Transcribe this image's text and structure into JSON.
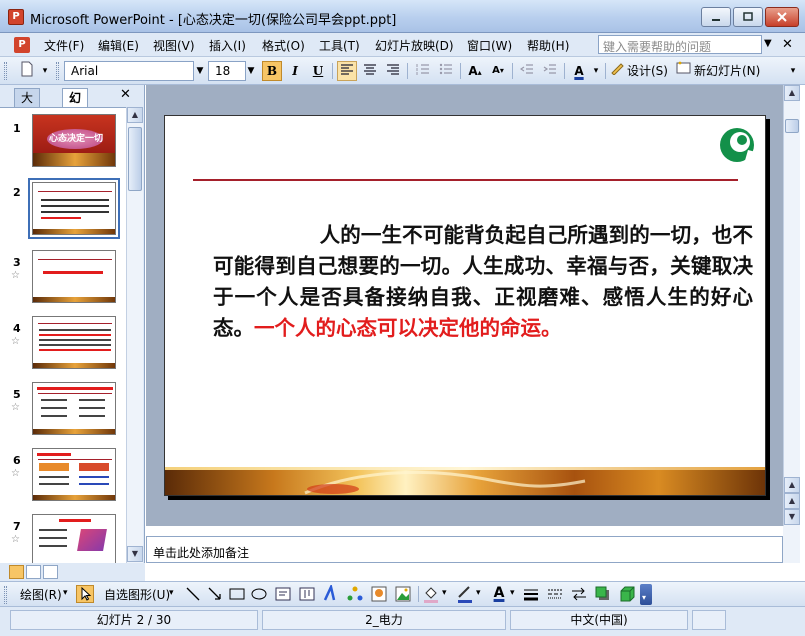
{
  "window": {
    "title": "Microsoft PowerPoint - [心态决定一切(保险公司早会ppt.ppt]"
  },
  "menu": {
    "items": [
      "文件(F)",
      "编辑(E)",
      "视图(V)",
      "插入(I)",
      "格式(O)",
      "工具(T)",
      "幻灯片放映(D)",
      "窗口(W)",
      "帮助(H)"
    ],
    "help_placeholder": "键入需要帮助的问题"
  },
  "toolbar": {
    "font_name": "Arial",
    "font_size": "18",
    "bold": "B",
    "italic": "I",
    "underline": "U",
    "design_label": "设计(S)",
    "new_slide_label": "新幻灯片(N)"
  },
  "panel": {
    "tabs": [
      "大纲",
      "幻灯片"
    ],
    "slide_numbers": [
      "1",
      "2",
      "3",
      "4",
      "5",
      "6",
      "7"
    ],
    "thumb1_title": "心态决定一切"
  },
  "slide": {
    "body_text": "人的一生不可能背负起自己所遇到的一切，也不可能得到自己想要的一切。人生成功、幸福与否，关键取决于一个人是否具备接纳自我、正视磨难、感悟人生的好心态。",
    "highlight_text": "一个人的心态可以决定他的命运。"
  },
  "notes": {
    "placeholder": "单击此处添加备注"
  },
  "drawing": {
    "draw_label": "绘图(R)",
    "autoshapes_label": "自选图形(U)"
  },
  "status": {
    "slide_info": "幻灯片 2 / 30",
    "design_name": "2_电力",
    "language": "中文(中国)"
  },
  "colors": {
    "accent_red": "#e21d1d",
    "line_red": "#a5202b",
    "logo_green": "#139049"
  }
}
